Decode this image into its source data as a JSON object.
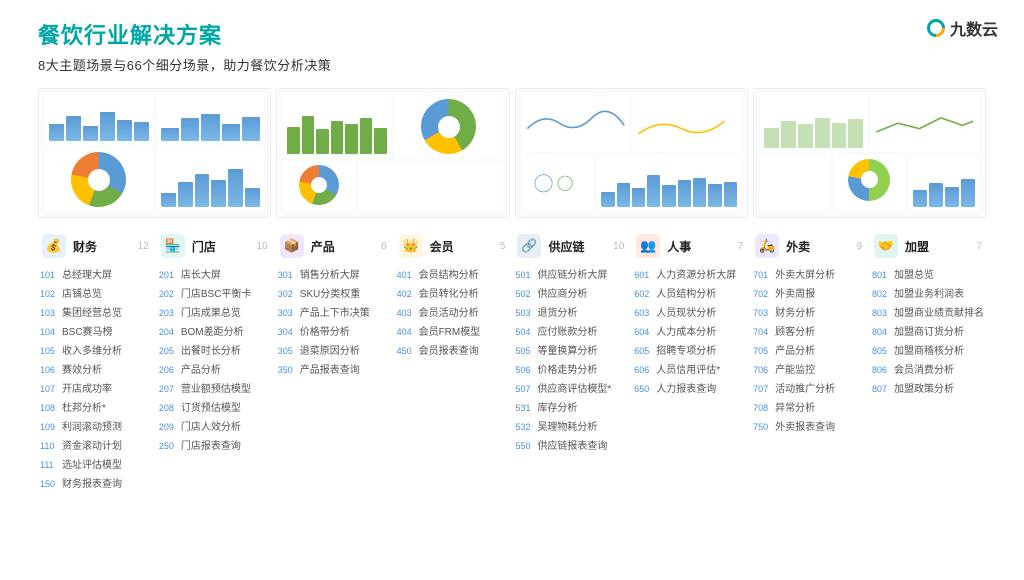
{
  "brand": "九数云",
  "title": "餐饮行业解决方案",
  "subtitle": "8大主题场景与66个细分场景，助力餐饮分析决策",
  "categories": [
    {
      "icon": "💰",
      "iconClass": "c-blue",
      "name": "财务",
      "count": "12",
      "items": [
        {
          "n": "101",
          "t": "总经理大屏"
        },
        {
          "n": "102",
          "t": "店铺总览"
        },
        {
          "n": "103",
          "t": "集团经营总览"
        },
        {
          "n": "104",
          "t": "BSC赛马榜"
        },
        {
          "n": "105",
          "t": "收入多维分析"
        },
        {
          "n": "106",
          "t": "赛效分析"
        },
        {
          "n": "107",
          "t": "开店成功率"
        },
        {
          "n": "108",
          "t": "杜邦分析*"
        },
        {
          "n": "109",
          "t": "利润滚动预测"
        },
        {
          "n": "110",
          "t": "资金滚动计划"
        },
        {
          "n": "111",
          "t": "选址评估模型"
        },
        {
          "n": "150",
          "t": "财务报表查询"
        }
      ]
    },
    {
      "icon": "🏪",
      "iconClass": "c-cyan",
      "name": "门店",
      "count": "10",
      "items": [
        {
          "n": "201",
          "t": "店长大屏"
        },
        {
          "n": "202",
          "t": "门店BSC平衡卡"
        },
        {
          "n": "203",
          "t": "门店成果总览"
        },
        {
          "n": "204",
          "t": "BOM差距分析"
        },
        {
          "n": "205",
          "t": "出餐时长分析"
        },
        {
          "n": "206",
          "t": "产品分析"
        },
        {
          "n": "207",
          "t": "营业额预估模型"
        },
        {
          "n": "208",
          "t": "订货预估模型"
        },
        {
          "n": "209",
          "t": "门店人效分析"
        },
        {
          "n": "250",
          "t": "门店报表查询"
        }
      ]
    },
    {
      "icon": "📦",
      "iconClass": "c-purple",
      "name": "产品",
      "count": "6",
      "items": [
        {
          "n": "301",
          "t": "销售分析大屏"
        },
        {
          "n": "302",
          "t": "SKU分类权重"
        },
        {
          "n": "303",
          "t": "产品上下市决策"
        },
        {
          "n": "304",
          "t": "价格带分析"
        },
        {
          "n": "305",
          "t": "退菜原因分析"
        },
        {
          "n": "350",
          "t": "产品报表查询"
        }
      ]
    },
    {
      "icon": "👑",
      "iconClass": "c-yellow",
      "name": "会员",
      "count": "5",
      "items": [
        {
          "n": "401",
          "t": "会员结构分析"
        },
        {
          "n": "402",
          "t": "会员转化分析"
        },
        {
          "n": "403",
          "t": "会员活动分析"
        },
        {
          "n": "404",
          "t": "会员FRM模型"
        },
        {
          "n": "450",
          "t": "会员报表查询"
        }
      ]
    },
    {
      "icon": "🔗",
      "iconClass": "c-navy",
      "name": "供应链",
      "count": "10",
      "items": [
        {
          "n": "501",
          "t": "供应链分析大屏"
        },
        {
          "n": "502",
          "t": "供应商分析"
        },
        {
          "n": "503",
          "t": "退货分析"
        },
        {
          "n": "504",
          "t": "应付账款分析"
        },
        {
          "n": "505",
          "t": "等量换算分析"
        },
        {
          "n": "506",
          "t": "价格走势分析"
        },
        {
          "n": "507",
          "t": "供应商评估模型*"
        },
        {
          "n": "531",
          "t": "库存分析"
        },
        {
          "n": "532",
          "t": "吴理物耗分析"
        },
        {
          "n": "550",
          "t": "供应链报表查询"
        }
      ]
    },
    {
      "icon": "👥",
      "iconClass": "c-orange",
      "name": "人事",
      "count": "7",
      "items": [
        {
          "n": "601",
          "t": "人力资源分析大屏"
        },
        {
          "n": "602",
          "t": "人员结构分析"
        },
        {
          "n": "603",
          "t": "人员现状分析"
        },
        {
          "n": "604",
          "t": "人力成本分析"
        },
        {
          "n": "605",
          "t": "招聘专项分析"
        },
        {
          "n": "606",
          "t": "人员信用评估*"
        },
        {
          "n": "650",
          "t": "人力报表查询"
        }
      ]
    },
    {
      "icon": "🛵",
      "iconClass": "c-violet",
      "name": "外卖",
      "count": "9",
      "items": [
        {
          "n": "701",
          "t": "外卖大屏分析"
        },
        {
          "n": "702",
          "t": "外卖周报"
        },
        {
          "n": "703",
          "t": "财务分析"
        },
        {
          "n": "704",
          "t": "顾客分析"
        },
        {
          "n": "705",
          "t": "产品分析"
        },
        {
          "n": "706",
          "t": "产能监控"
        },
        {
          "n": "707",
          "t": "活动推广分析"
        },
        {
          "n": "708",
          "t": "异常分析"
        },
        {
          "n": "750",
          "t": "外卖报表查询"
        }
      ]
    },
    {
      "icon": "🤝",
      "iconClass": "c-teal",
      "name": "加盟",
      "count": "7",
      "items": [
        {
          "n": "801",
          "t": "加盟总览"
        },
        {
          "n": "802",
          "t": "加盟业务利润表"
        },
        {
          "n": "803",
          "t": "加盟商业绩贡献排名"
        },
        {
          "n": "804",
          "t": "加盟商订货分析"
        },
        {
          "n": "805",
          "t": "加盟商稽核分析"
        },
        {
          "n": "806",
          "t": "会员消费分析"
        },
        {
          "n": "807",
          "t": "加盟政策分析"
        }
      ]
    }
  ]
}
